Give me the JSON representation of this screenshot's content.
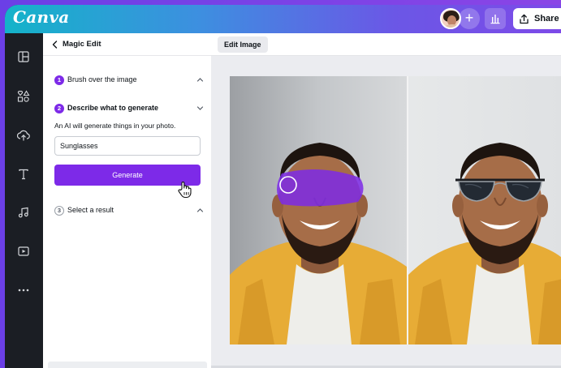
{
  "app": {
    "logo_text": "Canva",
    "share_label": "Share",
    "colors": {
      "brand_purple": "#7d2ae8",
      "topbar_start": "#14b3c9",
      "topbar_end": "#7d4ae8"
    }
  },
  "rail": {
    "items": [
      {
        "icon": "layout-icon"
      },
      {
        "icon": "elements-icon"
      },
      {
        "icon": "upload-icon"
      },
      {
        "icon": "text-icon"
      },
      {
        "icon": "music-icon"
      },
      {
        "icon": "video-icon"
      },
      {
        "icon": "more-icon"
      }
    ]
  },
  "panel": {
    "title": "Magic Edit",
    "steps": [
      {
        "number": "1",
        "label": "Brush over the image",
        "state": "done"
      },
      {
        "number": "2",
        "label": "Describe what to generate",
        "state": "active"
      },
      {
        "number": "3",
        "label": "Select a result",
        "state": "pending"
      }
    ],
    "description": "An AI will generate things in your photo.",
    "prompt_value": "Sunglasses",
    "generate_label": "Generate"
  },
  "workspace": {
    "tab_label": "Edit Image"
  }
}
